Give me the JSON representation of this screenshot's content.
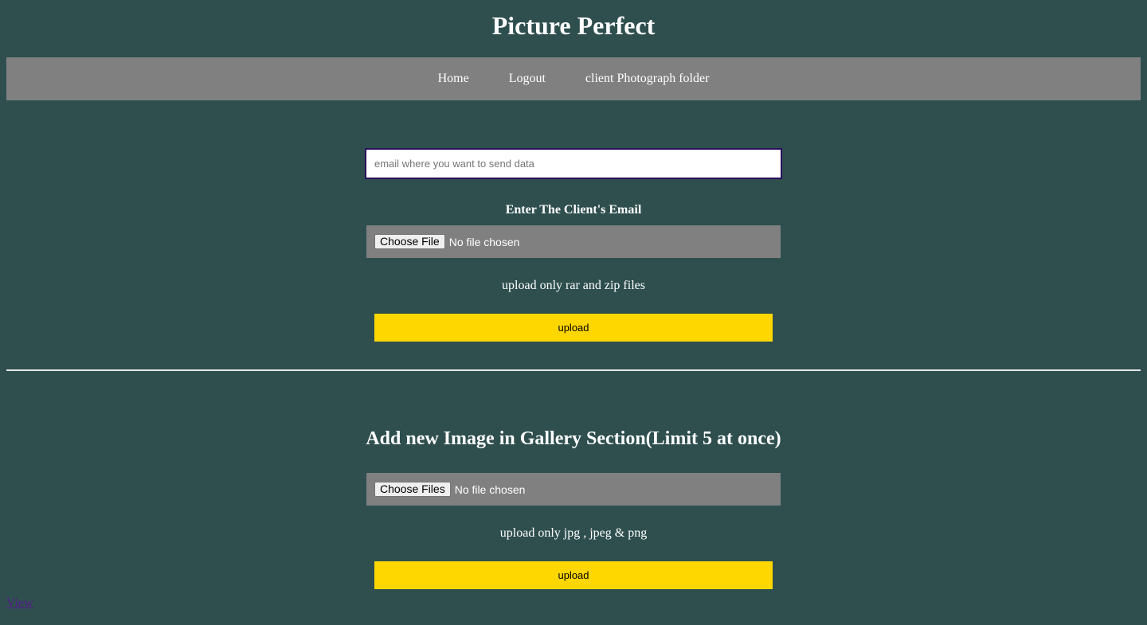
{
  "header": {
    "title": "Picture Perfect"
  },
  "nav": {
    "items": [
      {
        "label": "Home"
      },
      {
        "label": "Logout"
      },
      {
        "label": "client Photograph folder"
      }
    ]
  },
  "client_upload": {
    "email_placeholder": "email where you want to send data",
    "email_label": "Enter The Client's Email",
    "file_button": "Choose File",
    "file_status": "No file chosen",
    "hint": "upload only rar and zip files",
    "upload_label": "upload"
  },
  "gallery_upload": {
    "heading": "Add new Image in Gallery Section(Limit 5 at once)",
    "file_button": "Choose Files",
    "file_status": "No file chosen",
    "hint": "upload only jpg , jpeg & png",
    "upload_label": "upload"
  },
  "footer": {
    "view_link": "View"
  },
  "colors": {
    "background": "#2f4f4f",
    "nav_background": "#808080",
    "button_accent": "#ffd700",
    "visited_link": "#551a8b"
  }
}
